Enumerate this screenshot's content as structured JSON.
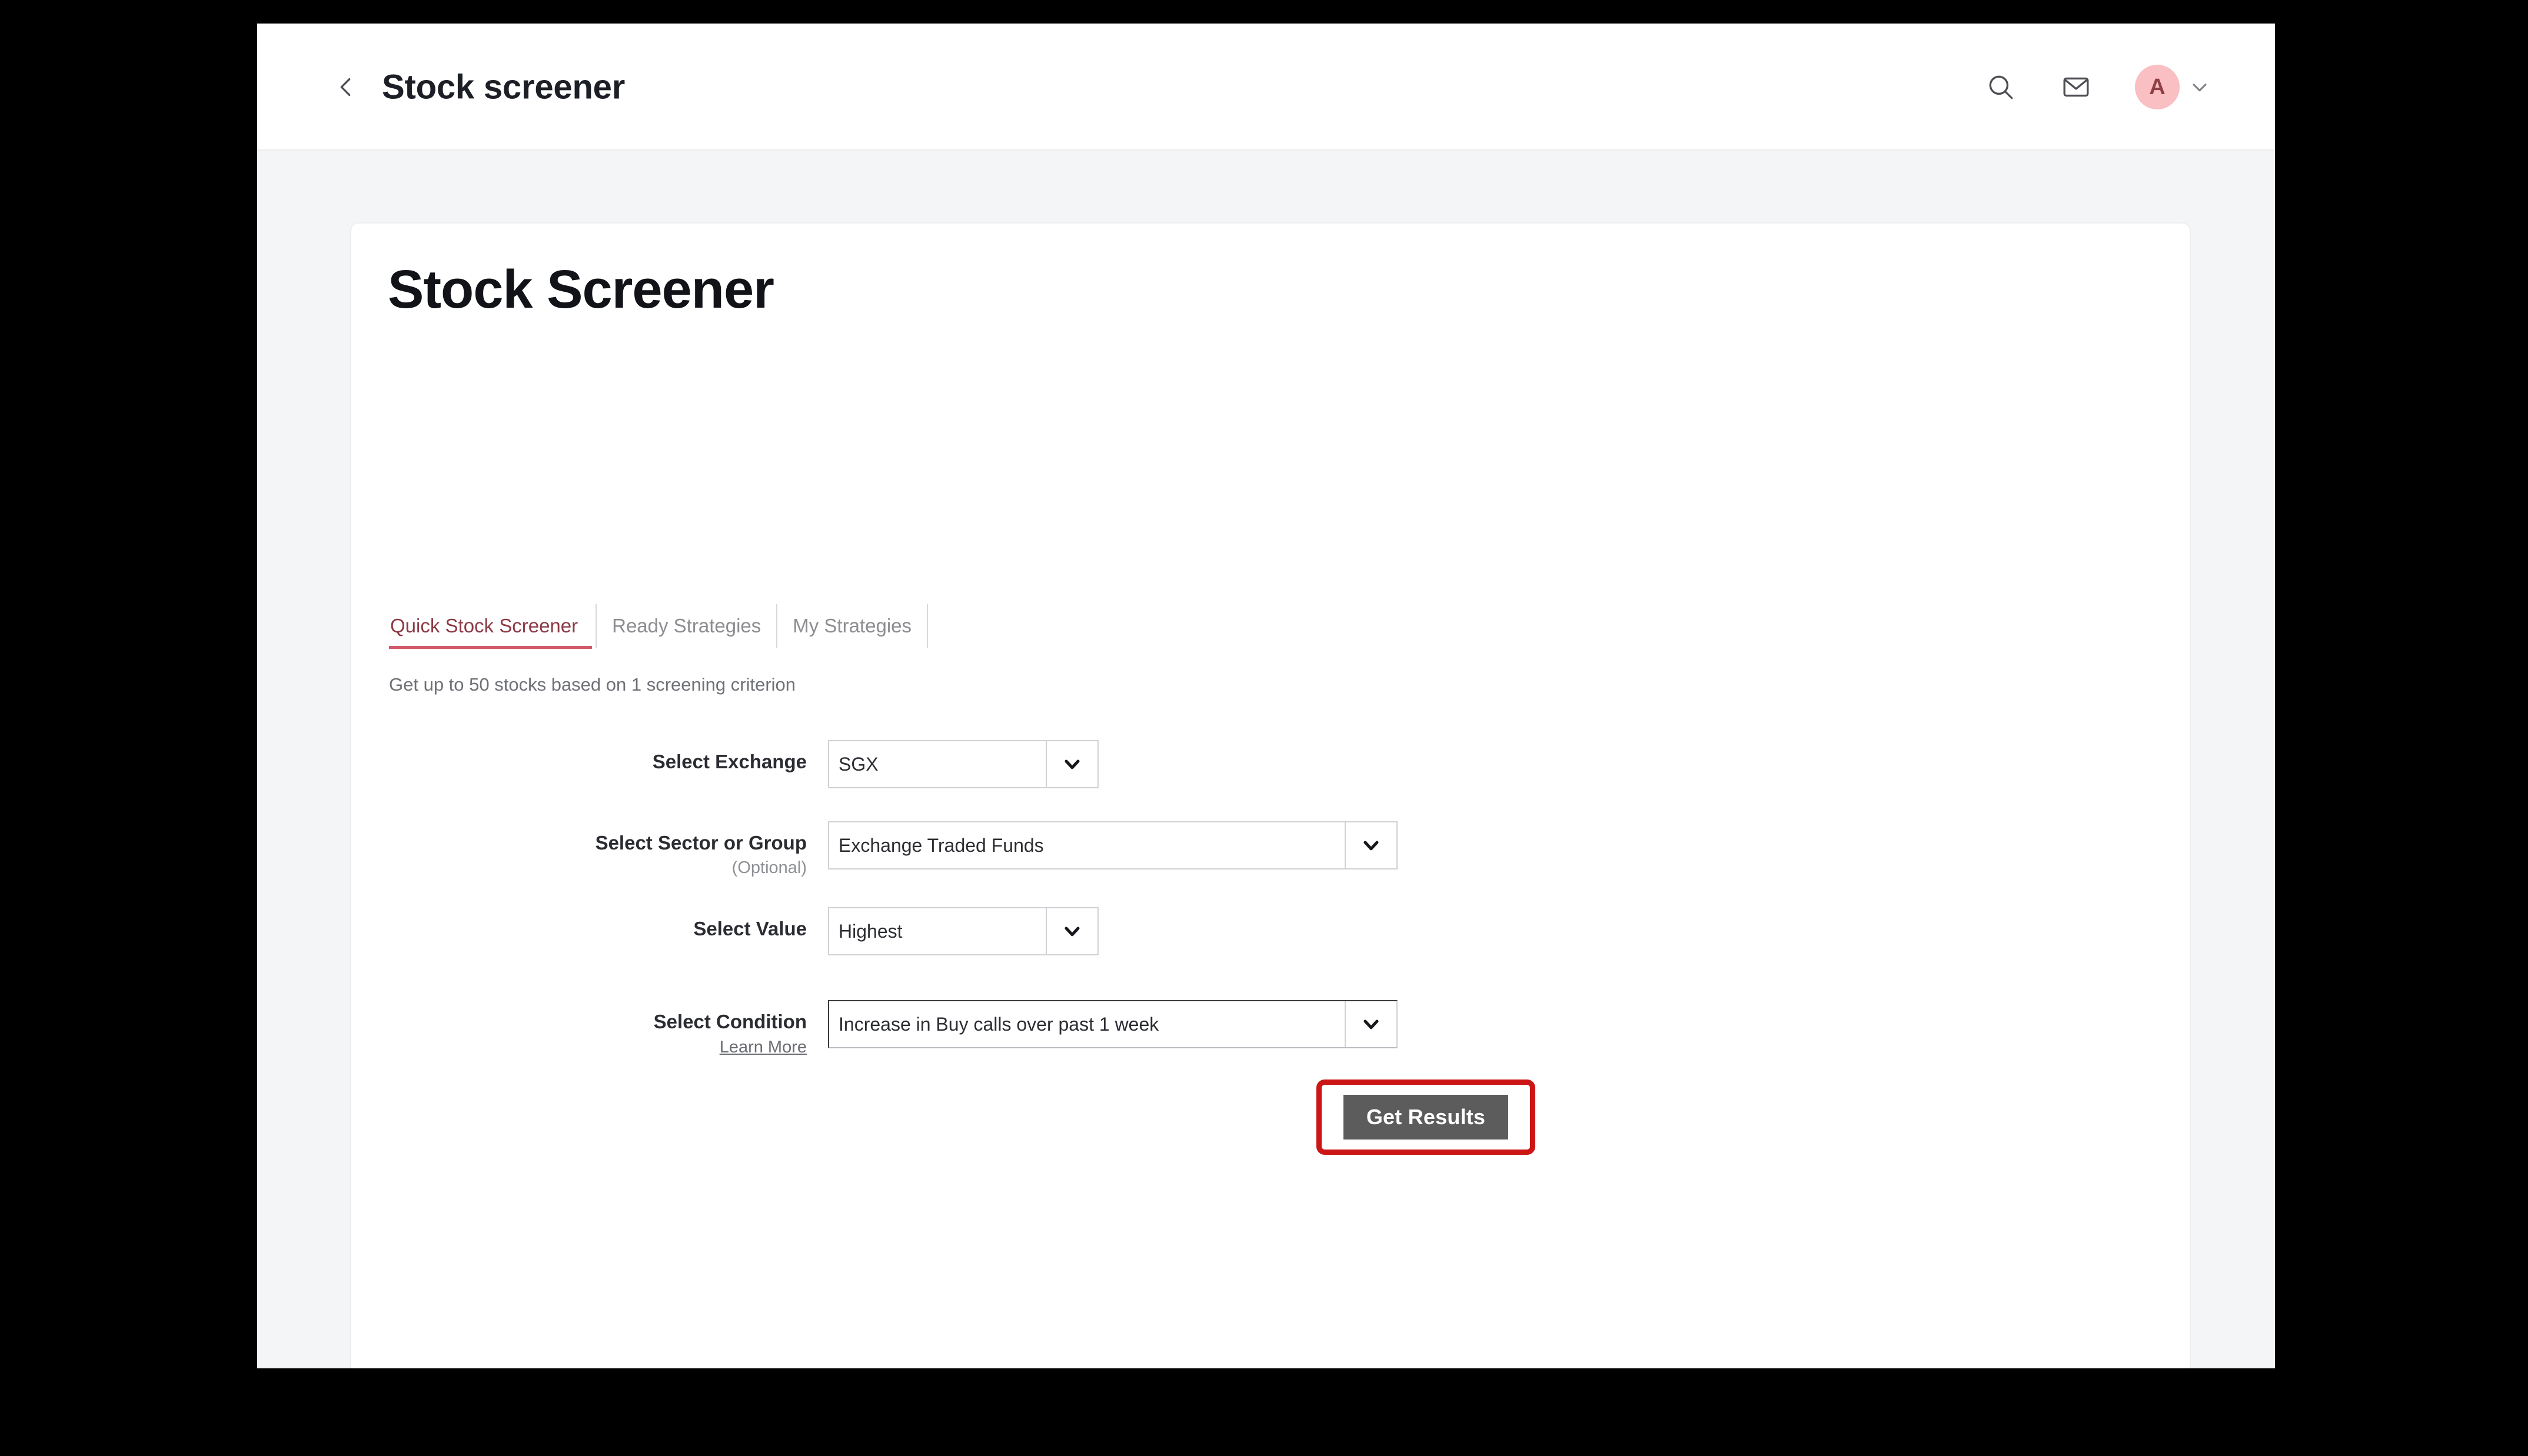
{
  "appbar": {
    "back_icon": "chevron-left-icon",
    "title": "Stock screener",
    "search_icon": "search-icon",
    "mail_icon": "envelope-icon",
    "avatar_initial": "A",
    "avatar_caret_icon": "chevron-down-icon",
    "avatar_bg": "#f9bfc2",
    "avatar_fg": "#8e4046"
  },
  "page": {
    "title": "Stock Screener",
    "subtitle": "Get up to 50 stocks based on 1 screening criterion"
  },
  "tabs": [
    {
      "label": "Quick Stock Screener",
      "active": true
    },
    {
      "label": "Ready Strategies",
      "active": false
    },
    {
      "label": "My Strategies",
      "active": false
    }
  ],
  "form": {
    "rows": [
      {
        "label": "Select Exchange",
        "sublabel": "",
        "link": "",
        "value": "SGX",
        "arrow_icon": "chevron-down-icon",
        "focused": false
      },
      {
        "label": "Select Sector or Group",
        "sublabel": "(Optional)",
        "link": "",
        "value": "Exchange Traded Funds",
        "arrow_icon": "chevron-down-icon",
        "focused": false
      },
      {
        "label": "Select Value",
        "sublabel": "",
        "link": "",
        "value": "Highest",
        "arrow_icon": "chevron-down-icon",
        "focused": false
      },
      {
        "label": "Select Condition",
        "sublabel": "",
        "link": "Learn More",
        "value": "Increase in Buy calls over past 1 week",
        "arrow_icon": "chevron-down-icon",
        "focused": true
      }
    ]
  },
  "actions": {
    "get_results_label": "Get Results",
    "highlight_color": "#cc1616",
    "button_color": "#5c5c5c"
  }
}
